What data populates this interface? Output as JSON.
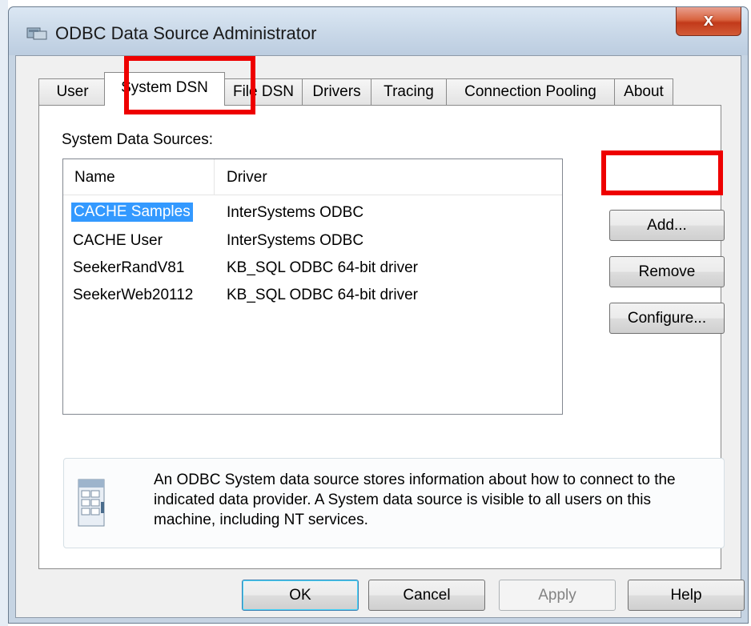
{
  "window": {
    "title": "ODBC Data Source Administrator",
    "close_label": "x"
  },
  "tabs": [
    {
      "label": "User DSN",
      "active": false
    },
    {
      "label": "System DSN",
      "active": true
    },
    {
      "label": "File DSN",
      "active": false
    },
    {
      "label": "Drivers",
      "active": false
    },
    {
      "label": "Tracing",
      "active": false
    },
    {
      "label": "Connection Pooling",
      "active": false
    },
    {
      "label": "About",
      "active": false
    }
  ],
  "panel": {
    "label": "System Data Sources:",
    "columns": {
      "name": "Name",
      "driver": "Driver"
    },
    "rows": [
      {
        "name": "CACHE Samples",
        "driver": "InterSystems ODBC",
        "selected": true
      },
      {
        "name": "CACHE User",
        "driver": "InterSystems ODBC",
        "selected": false
      },
      {
        "name": "SeekerRandV81",
        "driver": "KB_SQL ODBC 64-bit driver",
        "selected": false
      },
      {
        "name": "SeekerWeb20112",
        "driver": "KB_SQL ODBC 64-bit driver",
        "selected": false
      }
    ],
    "buttons": {
      "add": "Add...",
      "remove": "Remove",
      "configure": "Configure..."
    },
    "info_text": "An ODBC System data source stores information about how to connect to the indicated data provider.   A System data source is visible to all users on this machine, including NT services."
  },
  "footer": {
    "ok": "OK",
    "cancel": "Cancel",
    "apply": "Apply",
    "help": "Help"
  },
  "colors": {
    "highlight": "#ee0000",
    "selection": "#3399ff"
  },
  "icons": {
    "app": "odbc-app-icon",
    "info": "data-source-icon"
  }
}
